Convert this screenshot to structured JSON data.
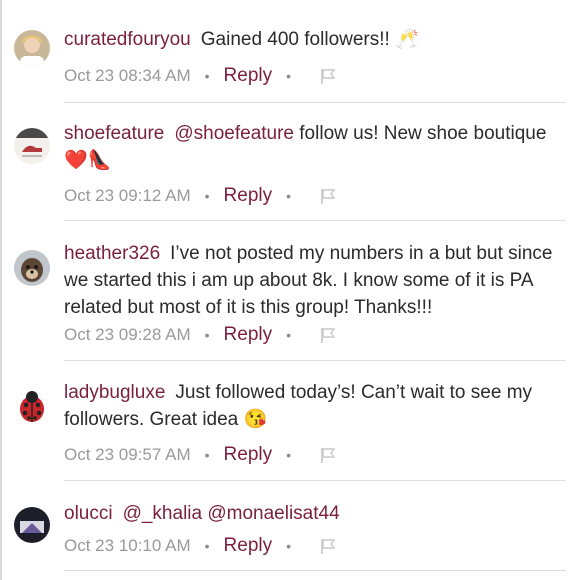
{
  "comments": [
    {
      "username": "curatedfouryou",
      "mention": "",
      "text": "Gained 400 followers!! 🥂",
      "timestamp": "Oct 23 08:34 AM",
      "reply_label": "Reply",
      "avatar_icon": "woman-portrait-avatar"
    },
    {
      "username": "shoefeature",
      "mention": "@shoefeature",
      "text": "follow us! New shoe boutique❤️👠",
      "timestamp": "Oct 23 09:12 AM",
      "reply_label": "Reply",
      "avatar_icon": "shoe-logo-avatar"
    },
    {
      "username": "heather326",
      "mention": "",
      "text": "I’ve not posted my numbers in a  but but since we started this i am up about 8k. I know some of it is PA related but most of it is this group!  Thanks!!!",
      "timestamp": "Oct 23 09:28 AM",
      "reply_label": "Reply",
      "avatar_icon": "dog-avatar"
    },
    {
      "username": "ladybugluxe",
      "mention": "",
      "text": "Just followed today’s! Can’t wait to see my followers. Great idea 😘",
      "timestamp": "Oct 23 09:57 AM",
      "reply_label": "Reply",
      "avatar_icon": "ladybug-avatar"
    },
    {
      "username": "olucci",
      "mention": "@_khalia",
      "text": "@monaelisat44",
      "timestamp": "Oct 23 10:10 AM",
      "reply_label": "Reply",
      "avatar_icon": "dark-logo-avatar"
    }
  ],
  "colors": {
    "username": "#7a1f3d",
    "body_text": "#2b2b2b",
    "timestamp": "#9a9a9a",
    "divider": "#dedede"
  }
}
